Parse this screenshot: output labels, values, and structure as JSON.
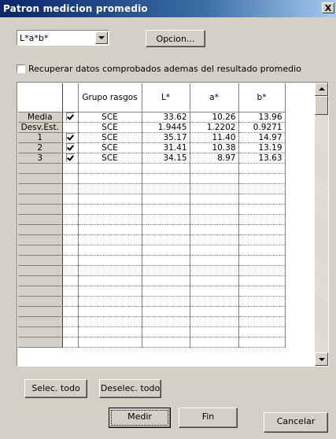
{
  "window": {
    "title": "Patron medicion promedio",
    "close_label": "X"
  },
  "color_space": {
    "selected": "L*a*b*"
  },
  "option_button": "Opcion...",
  "checkbox": {
    "label": "Recuperar datos comprobados ademas del resultado promedio",
    "checked": false
  },
  "table": {
    "headers": [
      "Grupo rasgos",
      "L*",
      "a*",
      "b*"
    ],
    "rows": [
      {
        "label": "Media",
        "checked": true,
        "group": "SCE",
        "L": "33.62",
        "a": "10.26",
        "b": "13.96"
      },
      {
        "label": "Desv.Est.",
        "checked": false,
        "group": "SCE",
        "L": "1.9445",
        "a": "1.2202",
        "b": "0.9271"
      },
      {
        "label": "1",
        "checked": true,
        "group": "SCE",
        "L": "35.17",
        "a": "11.40",
        "b": "14.97"
      },
      {
        "label": "2",
        "checked": true,
        "group": "SCE",
        "L": "31.41",
        "a": "10.38",
        "b": "13.19"
      },
      {
        "label": "3",
        "checked": true,
        "group": "SCE",
        "L": "34.15",
        "a": "8.97",
        "b": "13.63"
      }
    ],
    "empty_rows": 18
  },
  "buttons": {
    "select_all": "Selec. todo",
    "deselect_all": "Deselec. todo",
    "measure": "Medir",
    "end": "Fin",
    "cancel": "Cancelar"
  },
  "colors": {
    "title_bar": "#0a246a",
    "dialog_bg": "#d4d0c8"
  }
}
